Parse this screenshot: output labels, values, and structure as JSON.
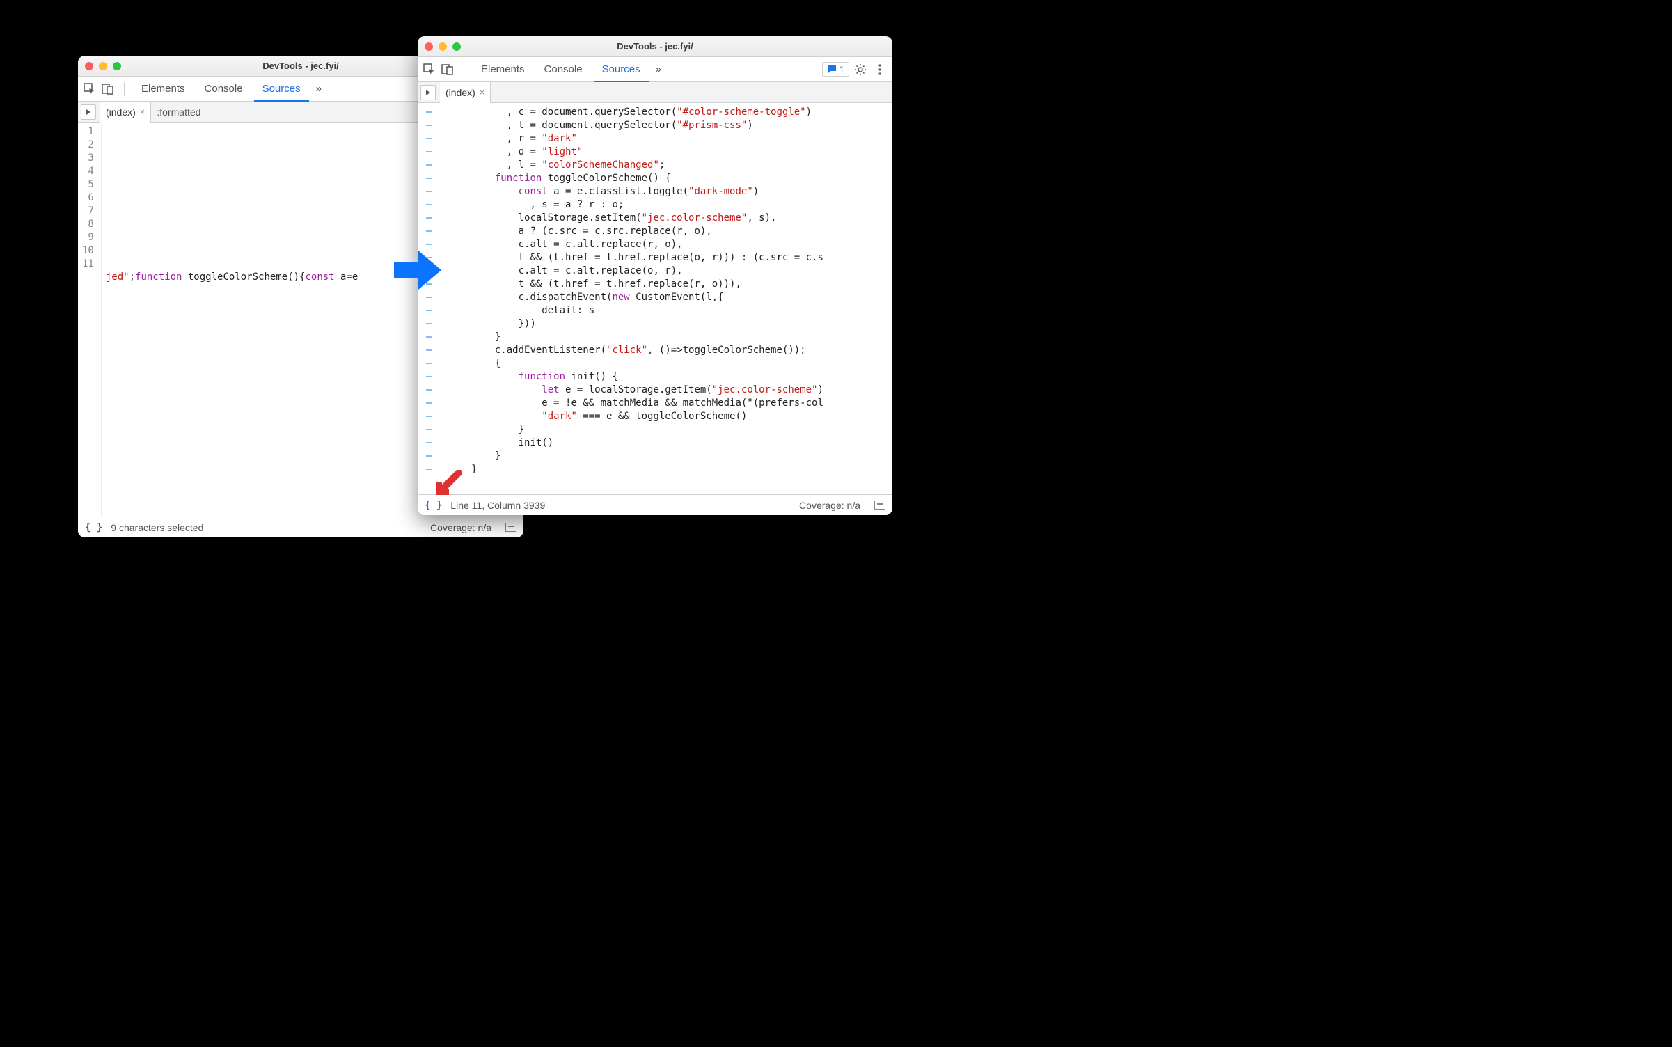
{
  "left": {
    "title": "DevTools - jec.fyi/",
    "tabs": {
      "elements": "Elements",
      "console": "Console",
      "sources": "Sources",
      "more": "»"
    },
    "fileTabs": {
      "index": "(index)",
      "formatted": ":formatted"
    },
    "gutterStart": 1,
    "gutterEnd": 11,
    "code11_a": "jed\"",
    "code11_b": ";",
    "code11_kw1": "function",
    "code11_fn": " toggleColorScheme(){",
    "code11_kw2": "const",
    "code11_tail": " a=e",
    "footer": {
      "status": "9 characters selected",
      "coverage": "Coverage: n/a"
    }
  },
  "right": {
    "title": "DevTools - jec.fyi/",
    "tabs": {
      "elements": "Elements",
      "console": "Console",
      "sources": "Sources",
      "more": "»"
    },
    "issueCount": "1",
    "fileTabs": {
      "index": "(index)"
    },
    "code": {
      "l01": "          , c = document.querySelector(\"#color-scheme-toggle\")",
      "l02": "          , t = document.querySelector(\"#prism-css\")",
      "l03": "          , r = \"dark\"",
      "l04": "          , o = \"light\"",
      "l05": "          , l = \"colorSchemeChanged\";",
      "l06": "        function toggleColorScheme() {",
      "l07": "            const a = e.classList.toggle(\"dark-mode\")",
      "l08": "              , s = a ? r : o;",
      "l09": "            localStorage.setItem(\"jec.color-scheme\", s),",
      "l10": "            a ? (c.src = c.src.replace(r, o),",
      "l11": "            c.alt = c.alt.replace(r, o),",
      "l12": "            t && (t.href = t.href.replace(o, r))) : (c.src = c.s",
      "l13": "            c.alt = c.alt.replace(o, r),",
      "l14": "            t && (t.href = t.href.replace(r, o))),",
      "l15": "            c.dispatchEvent(new CustomEvent(l,{",
      "l16": "                detail: s",
      "l17": "            }))",
      "l18": "        }",
      "l19": "        c.addEventListener(\"click\", ()=>toggleColorScheme());",
      "l20": "        {",
      "l21": "            function init() {",
      "l22": "                let e = localStorage.getItem(\"jec.color-scheme\")",
      "l23": "                e = !e && matchMedia && matchMedia(\"(prefers-col",
      "l24": "                \"dark\" === e && toggleColorScheme()",
      "l25": "            }",
      "l26": "            init()",
      "l27": "        }",
      "l28": "    }"
    },
    "footer": {
      "status": "Line 11, Column 3939",
      "coverage": "Coverage: n/a"
    }
  }
}
